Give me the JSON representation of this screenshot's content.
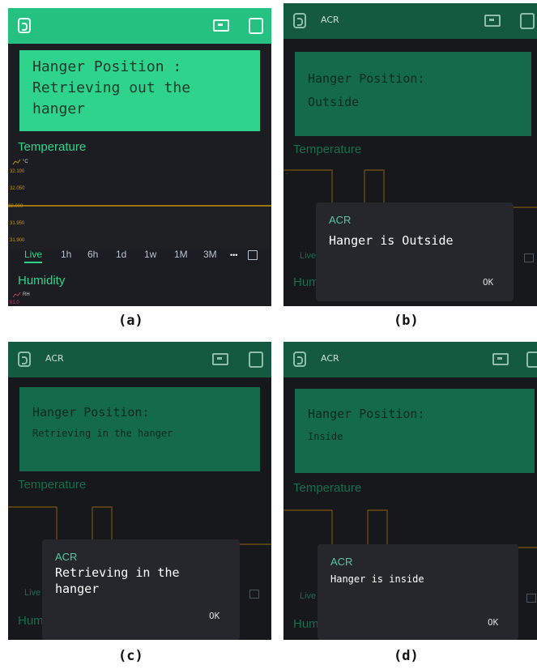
{
  "captions": [
    "(a)",
    "(b)",
    "(c)",
    "(d)"
  ],
  "panel_a": {
    "card_text_l1": "Hanger Position :",
    "card_text_l2": "Retrieving out the",
    "card_text_l3": "hanger",
    "temperature_label": "Temperature",
    "temp_unit": "°C",
    "y_ticks": [
      "32.100",
      "32.050",
      "32.000",
      "31.950",
      "31.900"
    ],
    "range_tabs": [
      "Live",
      "1h",
      "6h",
      "1d",
      "1w",
      "1M",
      "3M",
      "•••"
    ],
    "humidity_label": "Humidity",
    "humidity_unit": "RH",
    "humidity_tick": "61.0"
  },
  "panel_b": {
    "app_title": "ACR",
    "card_l1": "Hanger Position:",
    "card_l2": "Outside",
    "temperature_label": "Temperature",
    "dialog_app": "ACR",
    "dialog_msg": "Hanger is Outside",
    "ok": "OK",
    "humidity_label": "Hum",
    "live_tab": "Live"
  },
  "panel_c": {
    "app_title": "ACR",
    "card_l1": "Hanger Position:",
    "card_l2": "Retrieving in the hanger",
    "temperature_label": "Temperature",
    "dialog_app": "ACR",
    "dialog_msg_l1": "Retrieving in the",
    "dialog_msg_l2": "hanger",
    "ok": "OK",
    "humidity_label": "Hum",
    "live_tab": "Live"
  },
  "panel_d": {
    "app_title": "ACR",
    "card_l1": "Hanger Position:",
    "card_l2": "Inside",
    "temperature_label": "Temperature",
    "dialog_app": "ACR",
    "dialog_msg": "Hanger is inside",
    "ok": "OK",
    "humidity_label": "Hum",
    "live_tab": "Live"
  },
  "colors": {
    "accent": "#24c181",
    "accent_dim": "#135a40",
    "card_bright": "#2ed48c",
    "card_dim": "#146b4b",
    "dialog_bg": "#25272c",
    "chart_line": "#c8900a"
  }
}
